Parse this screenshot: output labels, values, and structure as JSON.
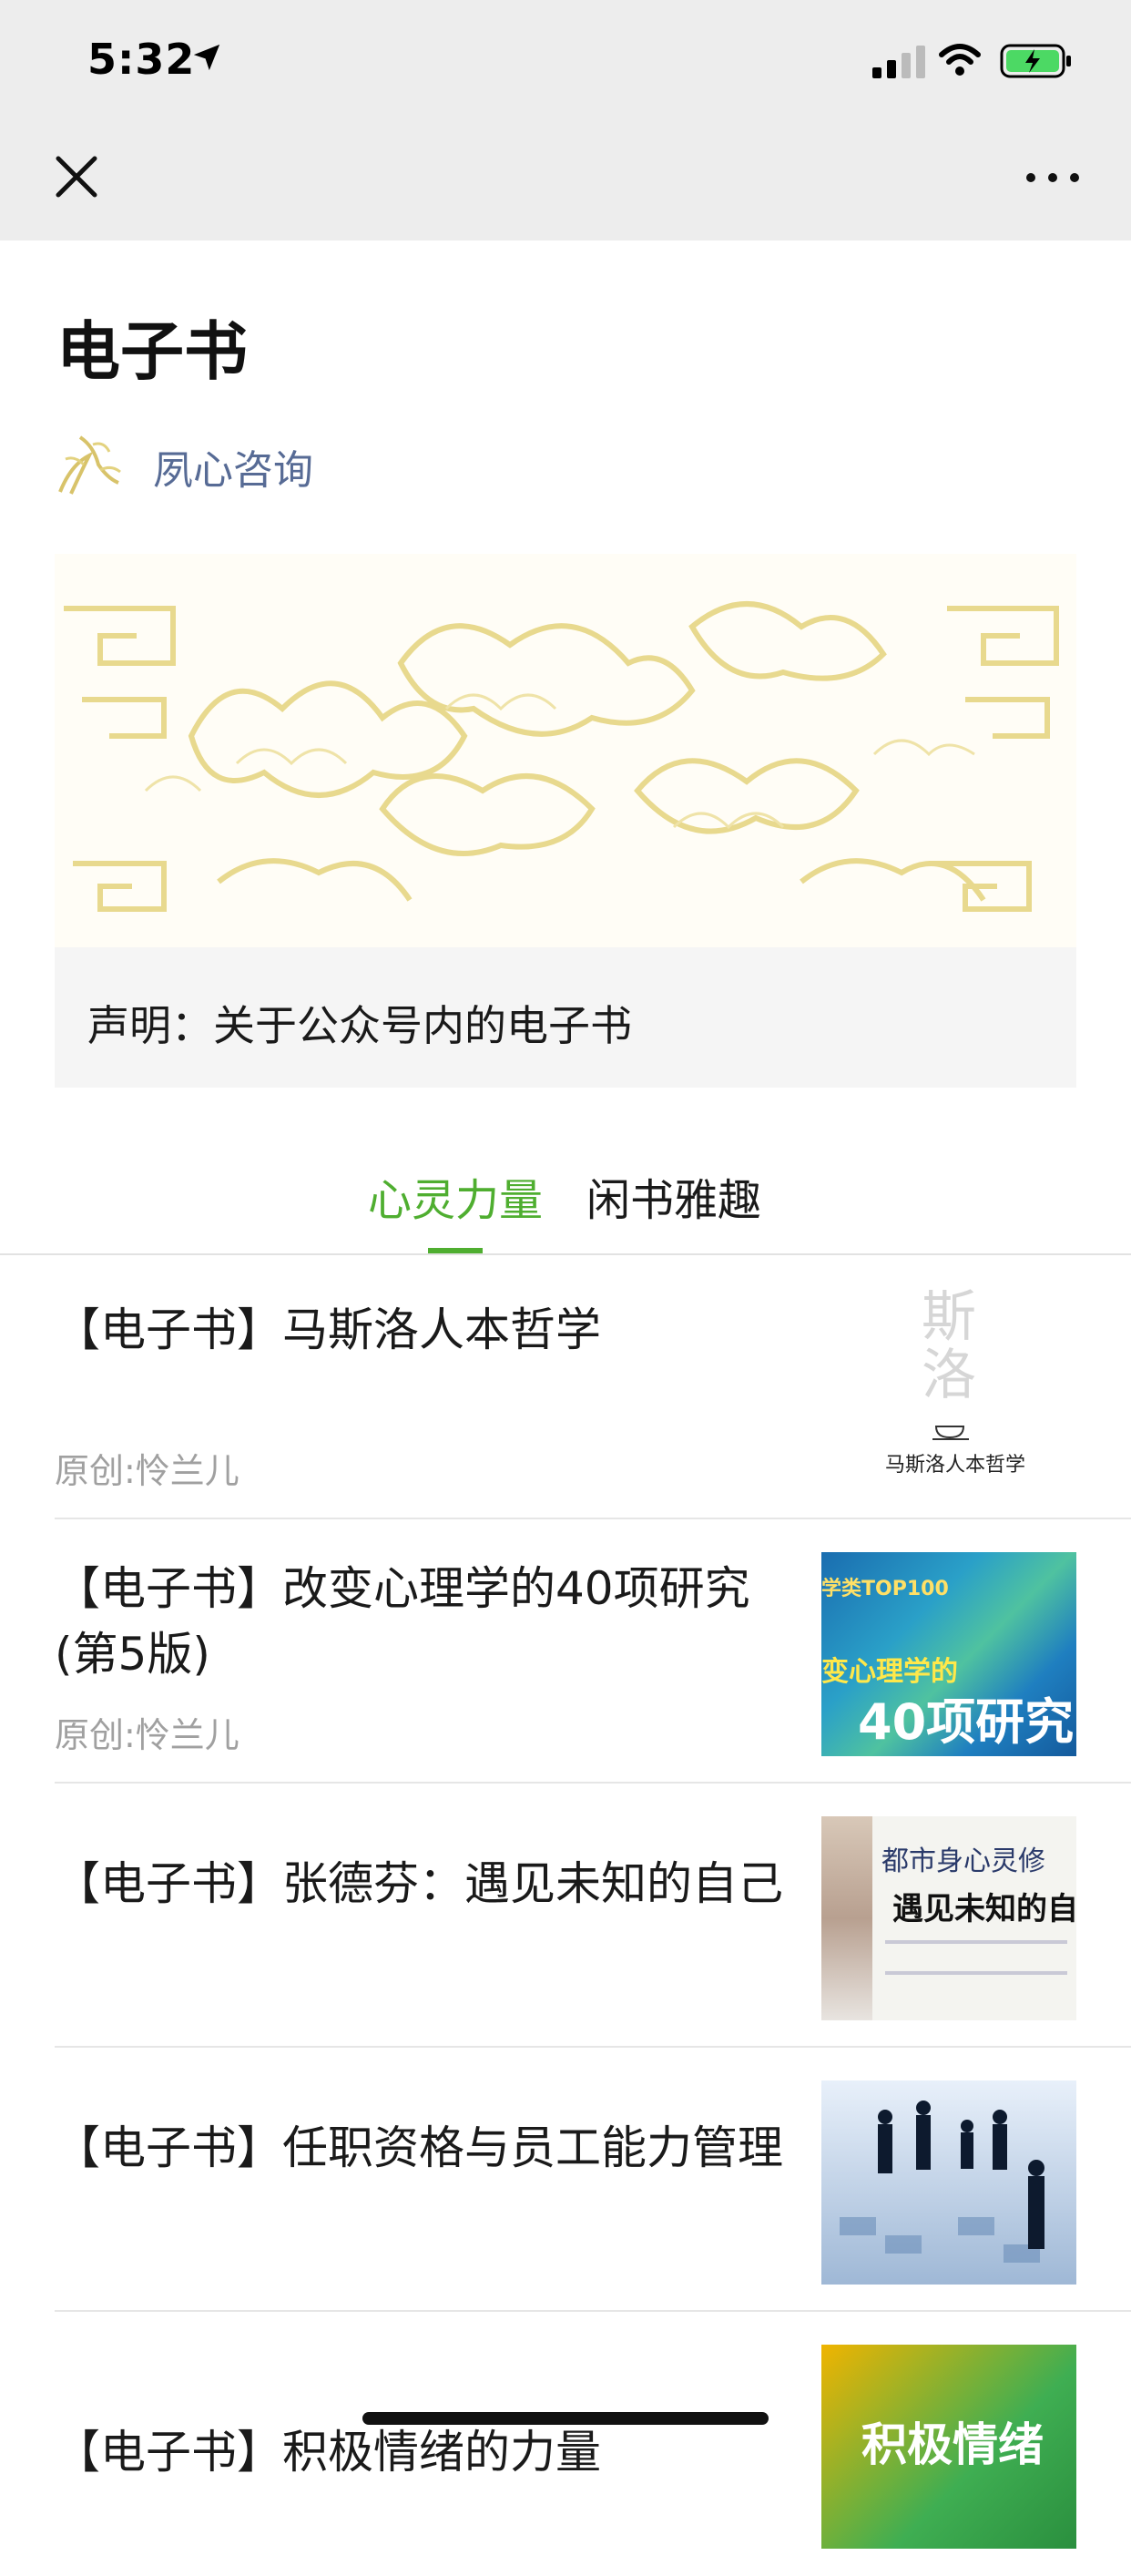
{
  "status_bar": {
    "time": "5:32"
  },
  "colors": {
    "accent": "#4fae30",
    "author": "#576b95",
    "meta": "#a0a0a0"
  },
  "article": {
    "title": "电子书",
    "author": "夙心咨询",
    "notice": "声明：关于公众号内的电子书"
  },
  "tabs": [
    {
      "label": "心灵力量",
      "active": true
    },
    {
      "label": "闲书雅趣",
      "active": false
    }
  ],
  "items": [
    {
      "title": "【电子书】马斯洛人本哲学",
      "meta": "原创:怜兰儿",
      "thumb_caption": "马斯洛人本哲学",
      "thumb_brush": "斯洛"
    },
    {
      "title": "【电子书】改变心理学的40项研究(第5版)",
      "meta": "原创:怜兰儿",
      "thumb_top": "学类TOP100",
      "thumb_mid": "变心理学的",
      "thumb_big": "40项研究"
    },
    {
      "title": "【电子书】张德芬：遇见未知的自己",
      "meta": "",
      "thumb_top": "都市身心灵修",
      "thumb_big": "遇见未知的自"
    },
    {
      "title": "【电子书】任职资格与员工能力管理",
      "meta": ""
    },
    {
      "title": "【电子书】积极情绪的力量",
      "meta": "",
      "thumb_big": "积极情绪"
    }
  ]
}
